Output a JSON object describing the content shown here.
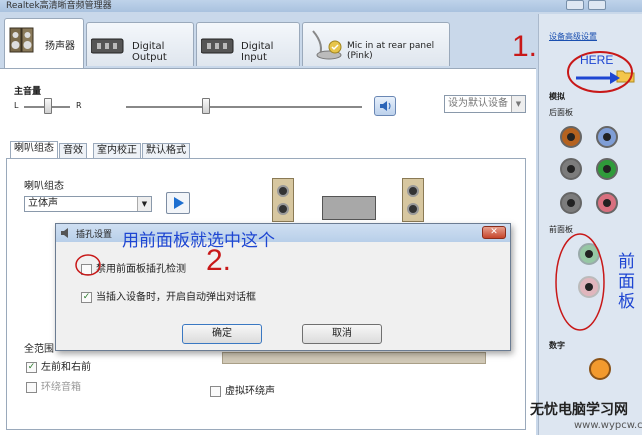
{
  "window": {
    "title": "Realtek高清晰音频管理器"
  },
  "device_tabs": [
    {
      "label": "扬声器"
    },
    {
      "label": "Digital Output"
    },
    {
      "label": "Digital Input"
    },
    {
      "label": "Mic in at rear panel (Pink)"
    }
  ],
  "main_volume": {
    "label": "主音量",
    "left": "L",
    "right": "R",
    "default_device": "设为默认设备"
  },
  "sub_tabs": [
    "喇叭组态",
    "音效",
    "室内校正",
    "默认格式"
  ],
  "speaker_config": {
    "label": "喇叭组态",
    "value": "立体声"
  },
  "fullrange": {
    "label": "全范围",
    "front": "左前和右前",
    "surround": "环绕音箱"
  },
  "virtual_surround": "虚拟环绕声",
  "right_panel": {
    "advanced_link": "设备高级设置",
    "analog": "模拟",
    "rear_panel": "后面板",
    "front_panel": "前面板",
    "digital": "数字"
  },
  "dialog": {
    "title": "插孔设置",
    "option1": "禁用前面板插孔检测",
    "option2": "当插入设备时，开启自动弹出对话框",
    "ok": "确定",
    "cancel": "取消"
  },
  "annotations": {
    "step1": "1.",
    "step2": "2.",
    "here": "HERE",
    "instruction": "用前面板就选中这个",
    "front_panel_vertical": "前面板"
  },
  "watermark": {
    "title": "无忧电脑学习网",
    "url": "www.wypcw.com"
  },
  "colors": {
    "annotation_red": "#c81818",
    "annotation_blue": "#1e46d2",
    "rear_jacks": [
      "#b5621f",
      "#7f9ed6",
      "#7c7c7c",
      "#2f9b3a",
      "#7c7c7c",
      "#d8707f"
    ],
    "front_jacks": [
      "#96c7a4",
      "#e0b6bd"
    ]
  }
}
